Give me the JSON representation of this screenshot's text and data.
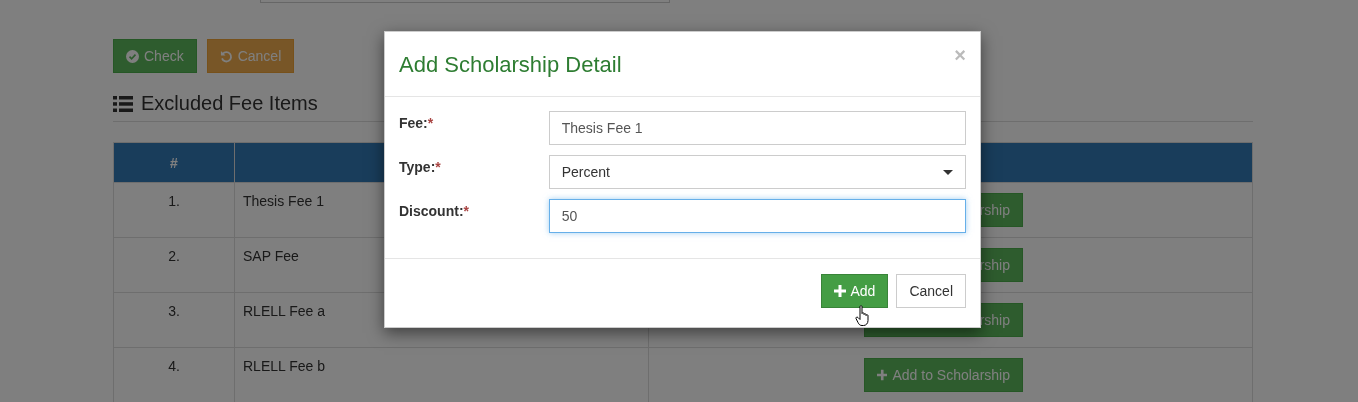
{
  "toolbar": {
    "buttons": [
      {
        "kind": "check",
        "label": "Check"
      },
      {
        "kind": "cancel",
        "label": "Cancel"
      }
    ]
  },
  "section": {
    "title": "Excluded Fee Items"
  },
  "table": {
    "columns": [
      "#"
    ],
    "rows": [
      {
        "number": "1.",
        "fee": "Thesis Fee 1",
        "action": {
          "label": "rship",
          "icon": false
        }
      },
      {
        "number": "2.",
        "fee": "SAP Fee",
        "action": {
          "label": "rship",
          "icon": false
        }
      },
      {
        "number": "3.",
        "fee": "RLELL Fee a",
        "action": {
          "label": "rship",
          "icon": false
        }
      },
      {
        "number": "4.",
        "fee": "RLELL Fee b",
        "action": {
          "label": "Add to Scholarship",
          "icon": true
        }
      }
    ]
  },
  "modal": {
    "title": "Add Scholarship Detail",
    "close": "×",
    "fields": [
      {
        "kind": "text",
        "label": "Fee:",
        "required_mark": "*",
        "value": "Thesis Fee 1",
        "focused": false
      },
      {
        "kind": "select",
        "label": "Type:",
        "required_mark": "*",
        "value": "Percent",
        "focused": false
      },
      {
        "kind": "text",
        "label": "Discount:",
        "required_mark": "*",
        "value": "50",
        "focused": true
      }
    ],
    "buttons": [
      {
        "kind": "primary",
        "label": "Add",
        "icon": true
      },
      {
        "kind": "default",
        "label": "Cancel",
        "icon": false
      }
    ]
  }
}
